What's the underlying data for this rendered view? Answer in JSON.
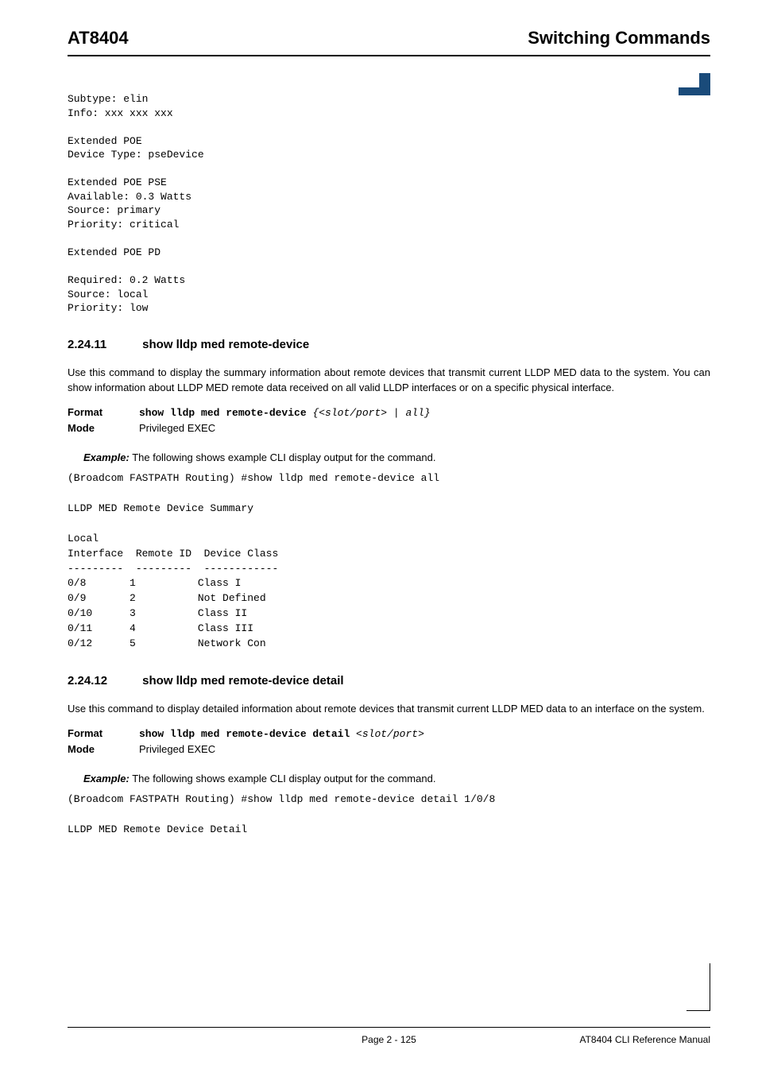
{
  "header": {
    "left": "AT8404",
    "right": "Switching Commands"
  },
  "code_top": "Subtype: elin\nInfo: xxx xxx xxx\n\nExtended POE\nDevice Type: pseDevice\n\nExtended POE PSE\nAvailable: 0.3 Watts\nSource: primary\nPriority: critical\n\nExtended POE PD\n\nRequired: 0.2 Watts\nSource: local\nPriority: low",
  "section1": {
    "num": "2.24.11",
    "title": "show lldp med remote-device",
    "body": "Use this command to display the summary information about remote devices that transmit current LLDP MED data to the system. You can show information about LLDP MED remote data received on all valid LLDP interfaces or on a specific physical interface.",
    "format_label": "Format",
    "format_cmd": "show lldp med remote-device",
    "format_arg": " {<slot/port> | all}",
    "mode_label": "Mode",
    "mode_value": "Privileged EXEC",
    "example_label": "Example:",
    "example_text": " The following shows example CLI display output for the command.",
    "cli": "(Broadcom FASTPATH Routing) #show lldp med remote-device all\n\nLLDP MED Remote Device Summary\n\nLocal\nInterface  Remote ID  Device Class\n---------  ---------  ------------\n0/8       1          Class I\n0/9       2          Not Defined\n0/10      3          Class II\n0/11      4          Class III\n0/12      5          Network Con"
  },
  "section2": {
    "num": "2.24.12",
    "title": "show lldp med remote-device detail",
    "body": "Use this command to display detailed information about remote devices that transmit current LLDP MED data to an interface on the system.",
    "format_label": "Format",
    "format_cmd": "show lldp med remote-device detail",
    "format_arg": " <slot/port>",
    "mode_label": "Mode",
    "mode_value": "Privileged EXEC",
    "example_label": "Example:",
    "example_text": " The following shows example CLI display output for the command.",
    "cli": "(Broadcom FASTPATH Routing) #show lldp med remote-device detail 1/0/8\n\nLLDP MED Remote Device Detail"
  },
  "footer": {
    "center": "Page 2 - 125",
    "right": "AT8404 CLI Reference Manual"
  }
}
